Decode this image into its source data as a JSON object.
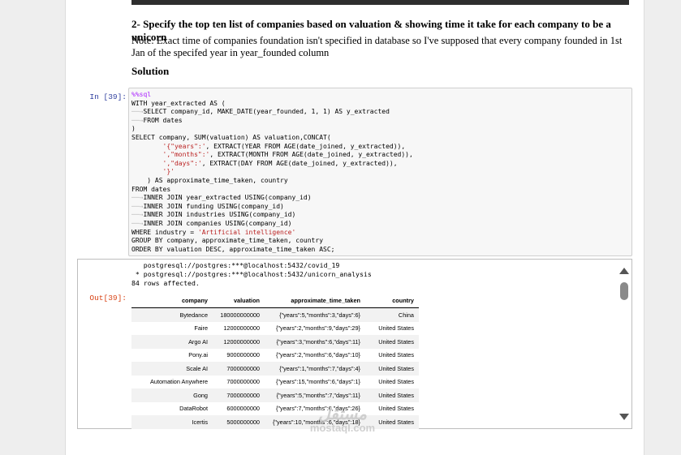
{
  "heading": "2- Specify the top ten list of companies based on valuation & showing time it take for each company to be a unicorn",
  "note_line1": "Note: Exact time of companies foundation isn't specified in database so I've supposed that every company founded in 1st",
  "note_line2": "Jan of the specifed year in year_founded column",
  "solution": "Solution",
  "in_prompt": "In [39]:",
  "out_prompt": "Out[39]:",
  "code": {
    "l01": "%%sql",
    "l02": "WITH year_extracted AS (",
    "l03": "SELECT company_id, MAKE_DATE(year_founded, 1, 1) AS y_extracted",
    "l04": "FROM dates",
    "l05": ")",
    "l06": "SELECT company, SUM(valuation) AS valuation,CONCAT(",
    "l07a": "        '{\"years\":'",
    "l07b": ", EXTRACT(YEAR FROM AGE(date_joined, y_extracted)),",
    "l08a": "        ',\"months\":'",
    "l08b": ", EXTRACT(MONTH FROM AGE(date_joined, y_extracted)),",
    "l09a": "        ',\"days\":'",
    "l09b": ", EXTRACT(DAY FROM AGE(date_joined, y_extracted)),",
    "l10": "        '}'",
    "l11": "    ) AS approximate_time_taken, country",
    "l12": "FROM dates",
    "l13": "INNER JOIN year_extracted USING(company_id)",
    "l14": "INNER JOIN funding USING(company_id)",
    "l15": "INNER JOIN industries USING(company_id)",
    "l16": "INNER JOIN companies USING(company_id)",
    "l17a": "WHERE industry = ",
    "l17b": "'Artificial intelligence'",
    "l18": "GROUP BY company, approximate_time_taken, country",
    "l19": "ORDER BY valuation DESC, approximate_time_taken ASC;"
  },
  "output": {
    "line1": "   postgresql://postgres:***@localhost:5432/covid_19",
    "line2": " * postgresql://postgres:***@localhost:5432/unicorn_analysis",
    "line3": "84 rows affected."
  },
  "table": {
    "headers": [
      "company",
      "valuation",
      "approximate_time_taken",
      "country"
    ],
    "rows": [
      [
        "Bytedance",
        "180000000000",
        "{\"years\":5,\"months\":3,\"days\":6}",
        "China"
      ],
      [
        "Faire",
        "12000000000",
        "{\"years\":2,\"months\":9,\"days\":29}",
        "United States"
      ],
      [
        "Argo AI",
        "12000000000",
        "{\"years\":3,\"months\":6,\"days\":11}",
        "United States"
      ],
      [
        "Pony.ai",
        "9000000000",
        "{\"years\":2,\"months\":6,\"days\":10}",
        "United States"
      ],
      [
        "Scale AI",
        "7000000000",
        "{\"years\":1,\"months\":7,\"days\":4}",
        "United States"
      ],
      [
        "Automation Anywhere",
        "7000000000",
        "{\"years\":15,\"months\":6,\"days\":1}",
        "United States"
      ],
      [
        "Gong",
        "7000000000",
        "{\"years\":5,\"months\":7,\"days\":11}",
        "United States"
      ],
      [
        "DataRobot",
        "6000000000",
        "{\"years\":7,\"months\":6,\"days\":26}",
        "United States"
      ],
      [
        "Icertis",
        "5000000000",
        "{\"years\":10,\"months\":6,\"days\":18}",
        "United States"
      ]
    ]
  },
  "watermark": {
    "line1": "مستقل",
    "line2": "mostaql.com"
  },
  "icons": {
    "scroll_up": "triangle-up",
    "scroll_down": "triangle-down"
  },
  "colors": {
    "in_prompt": "#303f9f",
    "out_prompt": "#d84315",
    "string": "#ba2121"
  }
}
